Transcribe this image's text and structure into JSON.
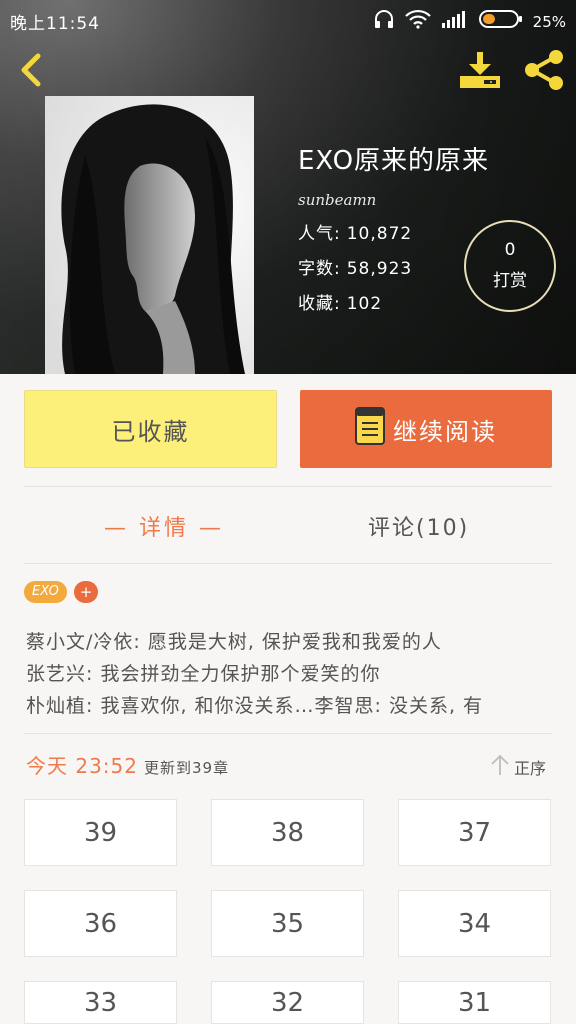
{
  "status_bar": {
    "time": "晚上11:54",
    "battery": "25%"
  },
  "book": {
    "title": "EXO原来的原来",
    "author": "sunbeamn",
    "stats": [
      {
        "label": "人气:",
        "value": "10,872"
      },
      {
        "label": "字数:",
        "value": "58,923"
      },
      {
        "label": "收藏:",
        "value": "102"
      }
    ],
    "reward": {
      "count": "0",
      "label": "打赏"
    }
  },
  "actions": {
    "favorited_label": "已收藏",
    "continue_label": "继续阅读"
  },
  "tabs": {
    "detail": "— 详情 —",
    "comments": "评论(10)"
  },
  "tags": {
    "primary": "EXO",
    "add": "+"
  },
  "description": [
    "蔡小文/冷依: 愿我是大树, 保护爱我和我爱的人",
    "张艺兴: 我会拼劲全力保护那个爱笑的你",
    "朴灿植: 我喜欢你, 和你没关系…李智思: 没关系, 有"
  ],
  "update": {
    "time": "今天 23:52",
    "text": "更新到39章"
  },
  "sort": {
    "label": "正序"
  },
  "chapters": [
    "39",
    "38",
    "37",
    "36",
    "35",
    "34",
    "33",
    "32",
    "31"
  ],
  "colors": {
    "accent": "#ea6b3e",
    "favorite": "#fdf07a",
    "icon_yellow": "#f4d73a"
  }
}
